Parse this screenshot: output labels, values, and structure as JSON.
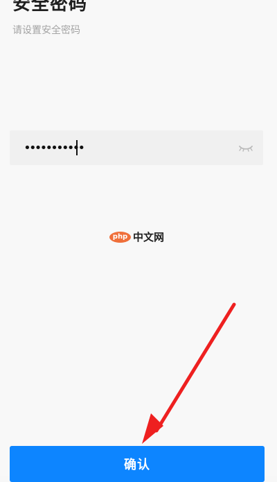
{
  "header": {
    "title": "安全密码",
    "subtitle": "请设置安全密码"
  },
  "password": {
    "value": "•••••••••••",
    "eye_icon": "eye-closed-icon"
  },
  "watermark": {
    "badge": "php",
    "text": "中文网"
  },
  "annotation": {
    "arrow_icon": "red-arrow-icon",
    "color": "#ee2020"
  },
  "actions": {
    "confirm_label": "确认",
    "confirm_color": "#0d85ff"
  }
}
